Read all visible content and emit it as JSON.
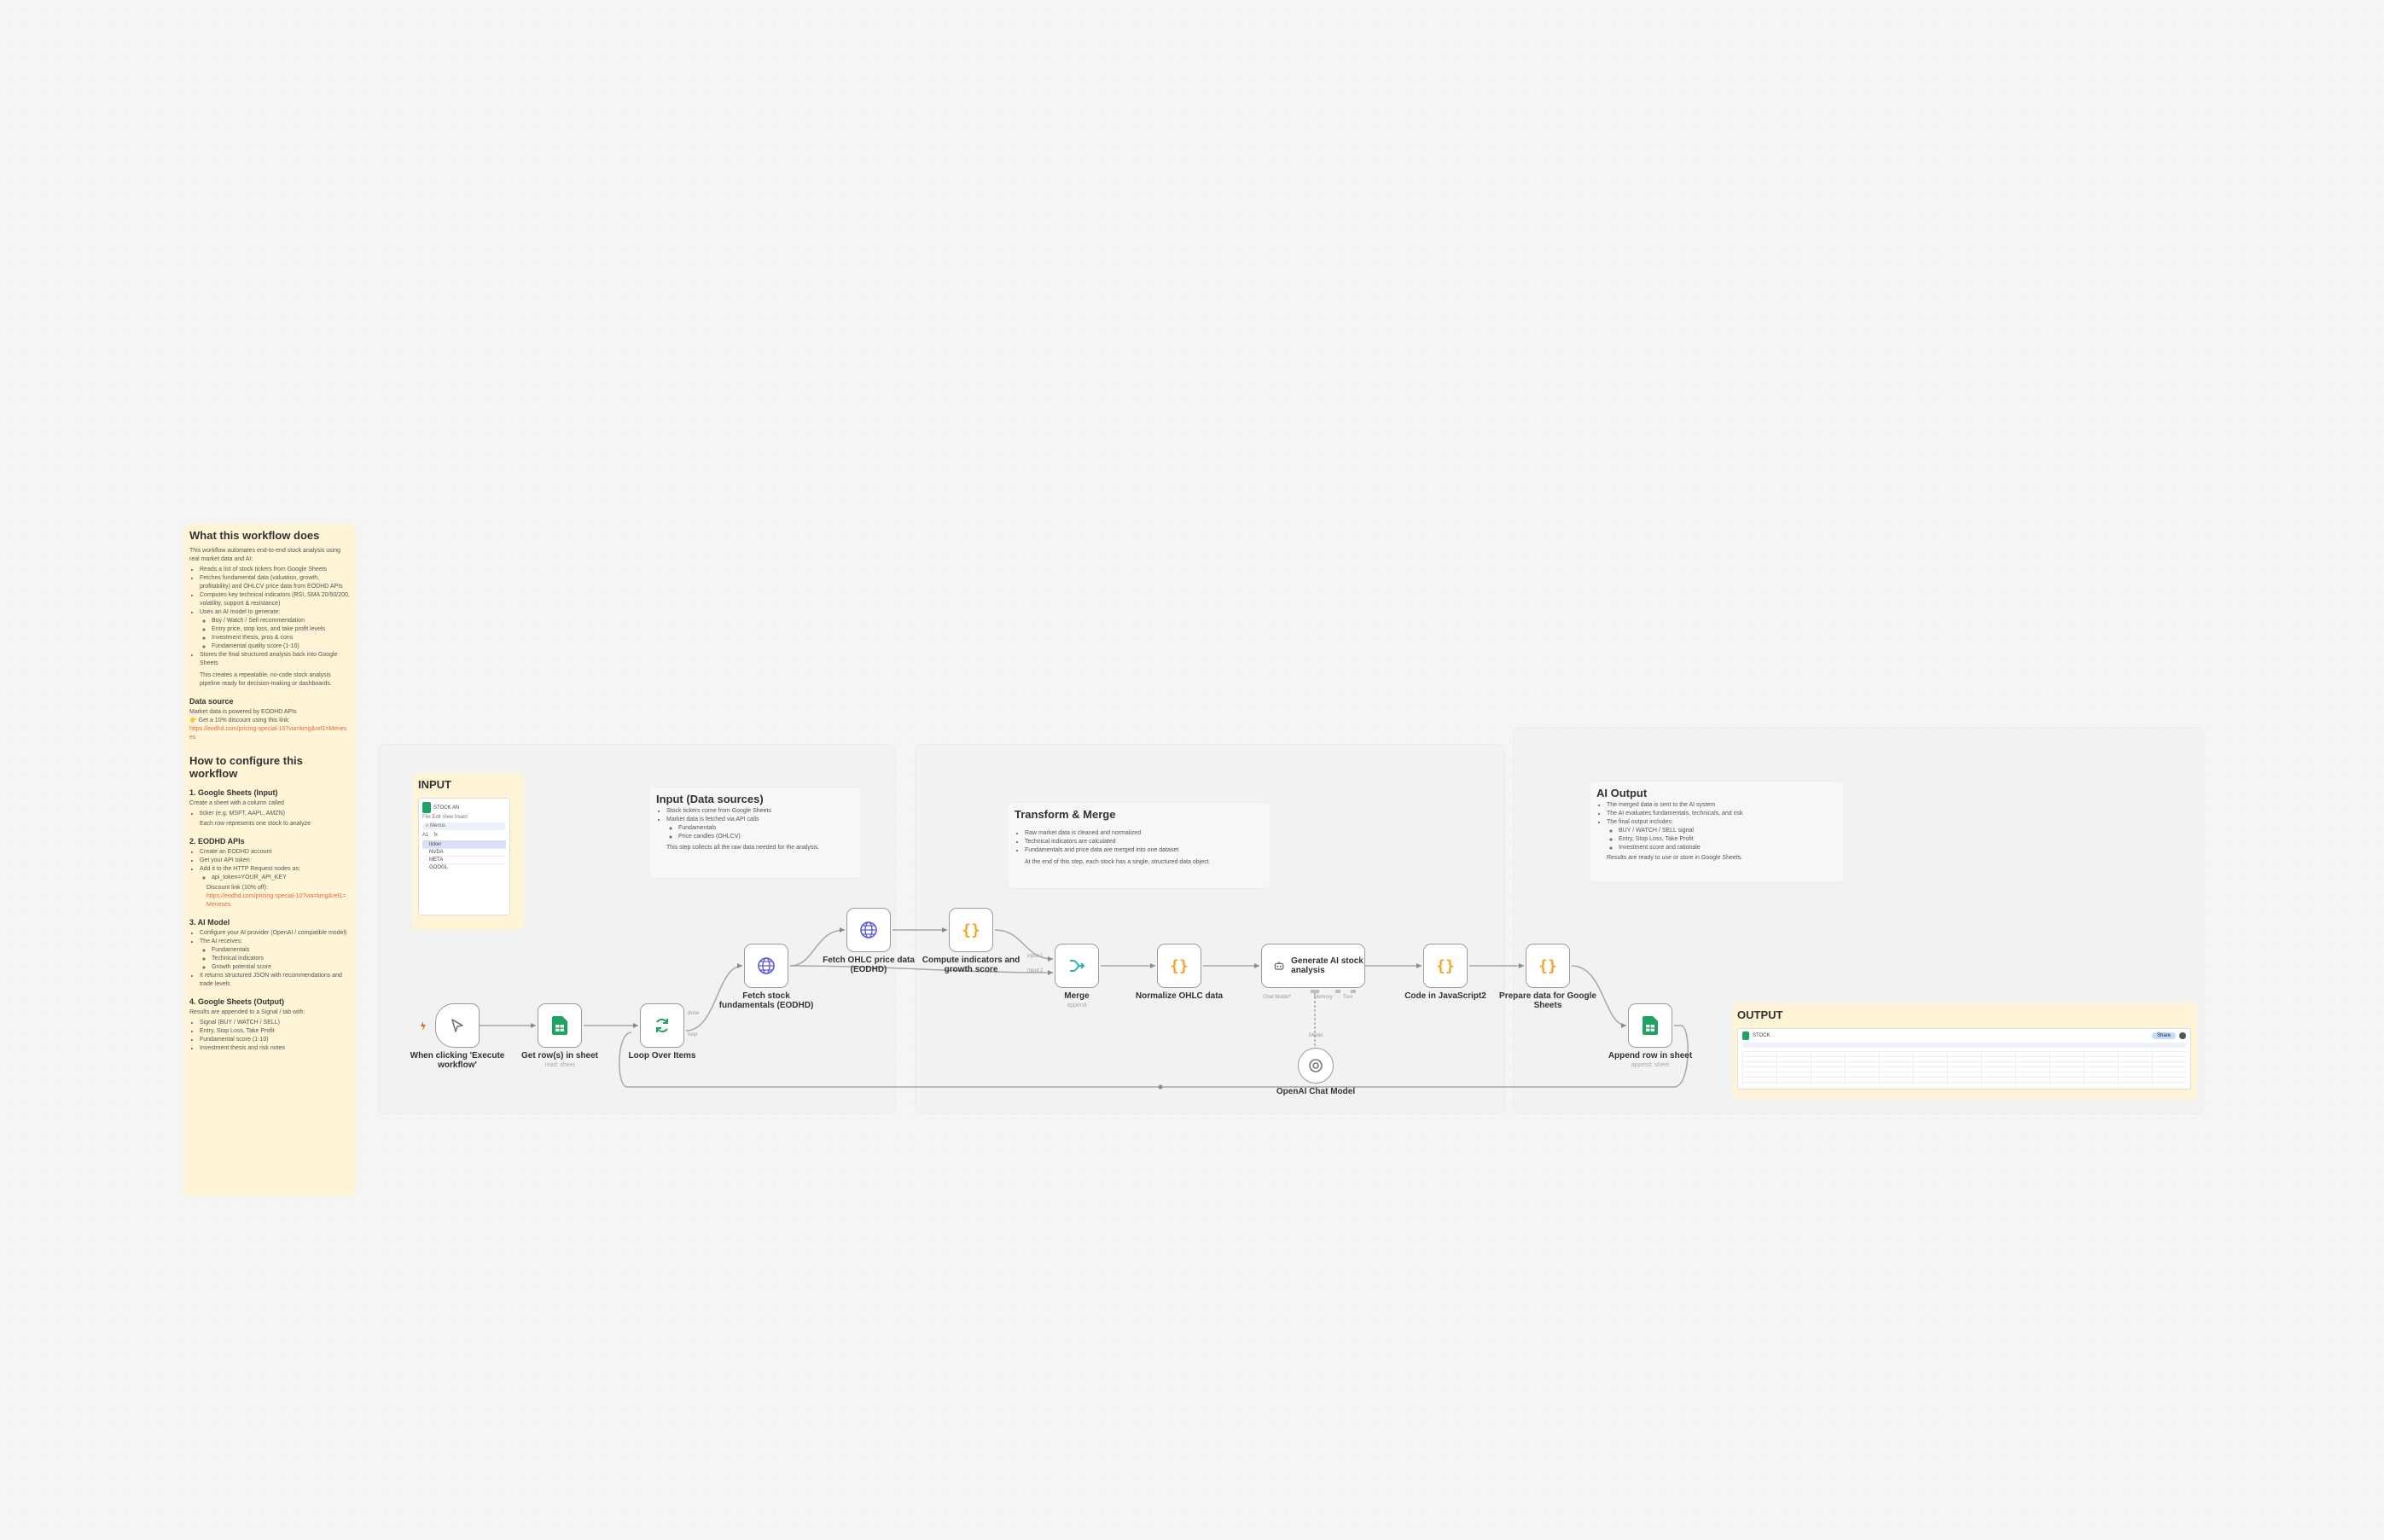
{
  "colors": {
    "canvas": "#f5f5f5",
    "sticky_yellow": "#fff4d6",
    "node_border": "#9a9a9a",
    "edge": "#a8a8a8",
    "sheets_green": "#1ea362",
    "http_blue": "#5b5bd6",
    "code_orange": "#f5a524",
    "merge_teal": "#2bb3b3",
    "link_orange": "#e46a3c"
  },
  "main_note": {
    "title": "What this workflow does",
    "intro": "This workflow automates end-to-end stock analysis using real market data and AI:",
    "bullets": [
      "Reads a list of stock tickers from Google Sheets",
      "Fetches fundamental data (valuation, growth, profitability) and OHLCV price data from EODHD APIs",
      "Computes key technical indicators (RSI, SMA 20/50/200, volatility, support & resistance)",
      "Uses an AI model to generate:"
    ],
    "sub_bullets": [
      "Buy / Watch / Sell recommendation",
      "Entry price, stop loss, and take profit levels",
      "Investment thesis, pros & cons",
      "Fundamental quality score (1-10)"
    ],
    "last_bullet": "Stores the final structured analysis back into Google Sheets",
    "summary": "This creates a repeatable, no-code stock analysis pipeline ready for decision-making or dashboards.",
    "data_source_title": "Data source",
    "data_source_text": "Market data is powered by EODHD APIs",
    "discount_text": "👉 Get a 10% discount using this link:",
    "discount_link": "https://eodhd.com/pricing-special-10?via=kmg&ref1=Meneses",
    "config_title": "How to configure this workflow",
    "s1_title": "1. Google Sheets (Input)",
    "s1_text": "Create a sheet with a column called",
    "s1_bullet": "ticker (e.g. MSFT, AAPL, AMZN)",
    "s1_note": "Each row represents one stock to analyze",
    "s2_title": "2. EODHD APIs",
    "s2_bullets": [
      "Create an EODHD account",
      "Get your API token",
      "Add it to the HTTP Request nodes as:"
    ],
    "s2_sub": "api_token=YOUR_API_KEY",
    "s2_discount": "Discount link (10% off):",
    "s2_link": "https://eodhd.com/pricing-special-10?via=kmg&ref1=Meneses",
    "s3_title": "3. AI Model",
    "s3_bullets": [
      "Configure your AI provider (OpenAI / compatible model)",
      "The AI receives:"
    ],
    "s3_sub": [
      "Fundamentals",
      "Technical indicators",
      "Growth potential score"
    ],
    "s3_last": "It returns structured JSON with recommendations and trade levels",
    "s4_title": "4. Google Sheets (Output)",
    "s4_text": "Results are appended to a Signal / tab with:",
    "s4_bullets": [
      "Signal (BUY / WATCH / SELL)",
      "Entry, Stop Loss, Take Profit",
      "Fundamental score (1-10)",
      "Investment thesis and risk notes"
    ]
  },
  "input_note": {
    "title": "INPUT",
    "sheet_title": "STOCK AN",
    "sheet_menu": "File Edit View Insert",
    "search": "Menus",
    "cell_ref": "A1",
    "col_header": "fx",
    "rows": [
      "ticker",
      "NVDA",
      "META",
      "GOOGL"
    ]
  },
  "sources_note": {
    "title": "Input (Data sources)",
    "bullets": [
      "Stock tickers come from Google Sheets",
      "Market data is fetched via API calls"
    ],
    "sub": [
      "Fundamentals",
      "Price candles (OHLCV)"
    ],
    "footer": "This step collects all the raw data needed for the analysis."
  },
  "transform_note": {
    "title": "Transform & Merge",
    "bullets": [
      "Raw market data is cleaned and normalized",
      "Technical indicators are calculated",
      "Fundamentals and price data are merged into one dataset"
    ],
    "footer": "At the end of this step, each stock has a single, structured data object."
  },
  "ai_note": {
    "title": "AI Output",
    "bullets": [
      "The merged data is sent to the AI system",
      "The AI evaluates fundamentals, technicals, and risk",
      "The final output includes:"
    ],
    "sub": [
      "BUY / WATCH / SELL signal",
      "Entry, Stop Loss, Take Profit",
      "Investment score and rationale"
    ],
    "footer": "Results are ready to use or store in Google Sheets."
  },
  "output_note": {
    "title": "OUTPUT",
    "sheet_title": "STOCK",
    "share_label": "Share"
  },
  "nodes": {
    "trigger": {
      "label": "When clicking 'Execute workflow'"
    },
    "get_rows": {
      "label": "Get row(s) in sheet",
      "sub": "read: sheet"
    },
    "loop": {
      "label": "Loop Over Items",
      "port_done": "done",
      "port_loop": "loop"
    },
    "fetch_fund": {
      "label": "Fetch stock fundamentals (EODHD)"
    },
    "fetch_ohlc": {
      "label": "Fetch OHLC price data (EODHD)"
    },
    "compute": {
      "label": "Compute indicators and growth score"
    },
    "merge": {
      "label": "Merge",
      "sub": "append",
      "port1": "Input 1",
      "port2": "Input 2"
    },
    "normalize": {
      "label": "Normalize OHLC data"
    },
    "generate": {
      "label": "Generate AI stock analysis",
      "port_model": "Chat Model*",
      "port_memory": "Memory",
      "port_tool": "Tool"
    },
    "code": {
      "label": "Code in JavaScript2"
    },
    "prepare": {
      "label": "Prepare data for Google Sheets"
    },
    "append": {
      "label": "Append row in sheet",
      "sub": "append: sheet"
    },
    "openai": {
      "label": "OpenAI Chat Model",
      "port_model": "Model"
    }
  }
}
